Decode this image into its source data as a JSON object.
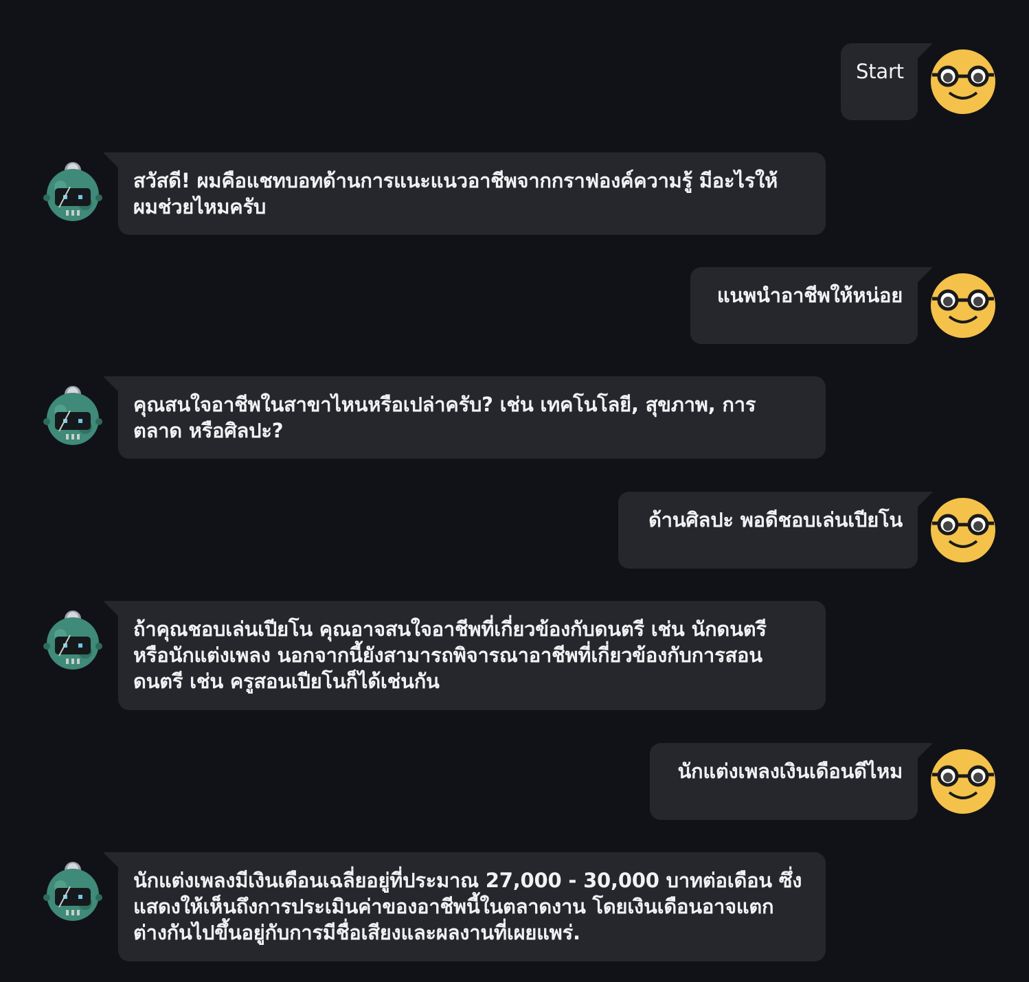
{
  "messages": [
    {
      "role": "user",
      "text": "Start"
    },
    {
      "role": "bot",
      "text": "สวัสดี! ผมคือแชทบอทด้านการแนะแนวอาชีพจากกราฟองค์ความรู้ มีอะไรให้\nผมช่วยไหมครับ"
    },
    {
      "role": "user",
      "text": "แนพนำอาชีพให้หน่อย"
    },
    {
      "role": "bot",
      "text": "คุณสนใจอาชีพในสาขาไหนหรือเปล่าครับ? เช่น เทคโนโลยี, สุขภาพ, การ\nตลาด หรือศิลปะ?"
    },
    {
      "role": "user",
      "text": "ด้านศิลปะ พอดีชอบเล่นเปียโน"
    },
    {
      "role": "bot",
      "text": "ถ้าคุณชอบเล่นเปียโน คุณอาจสนใจอาชีพที่เกี่ยวข้องกับดนตรี เช่น นักดนตรี\nหรือนักแต่งเพลง นอกจากนี้ยังสามารถพิจารณาอาชีพที่เกี่ยวข้องกับการสอน\nดนตรี เช่น ครูสอนเปียโนก็ได้เช่นกัน"
    },
    {
      "role": "user",
      "text": "นักแต่งเพลงเงินเดือนดีไหม"
    },
    {
      "role": "bot",
      "text": "นักแต่งเพลงมีเงินเดือนเฉลี่ยอยู่ที่ประมาณ 27,000 - 30,000 บาทต่อเดือน ซึ่ง\nแสดงให้เห็นถึงการประเมินค่าของอาชีพนี้ในตลาดงาน โดยเงินเดือนอาจแตก\nต่างกันไปขึ้นอยู่กับการมีชื่อเสียงและผลงานที่เผยแพร่."
    }
  ],
  "icons": {
    "user_avatar": "nerd-face-icon",
    "bot_avatar": "robot-icon"
  },
  "colors": {
    "background": "#111217",
    "bubble": "#26272d",
    "text": "#f2f2f4",
    "user_avatar": "#f4c24a",
    "bot_avatar": "#3f8a78"
  }
}
